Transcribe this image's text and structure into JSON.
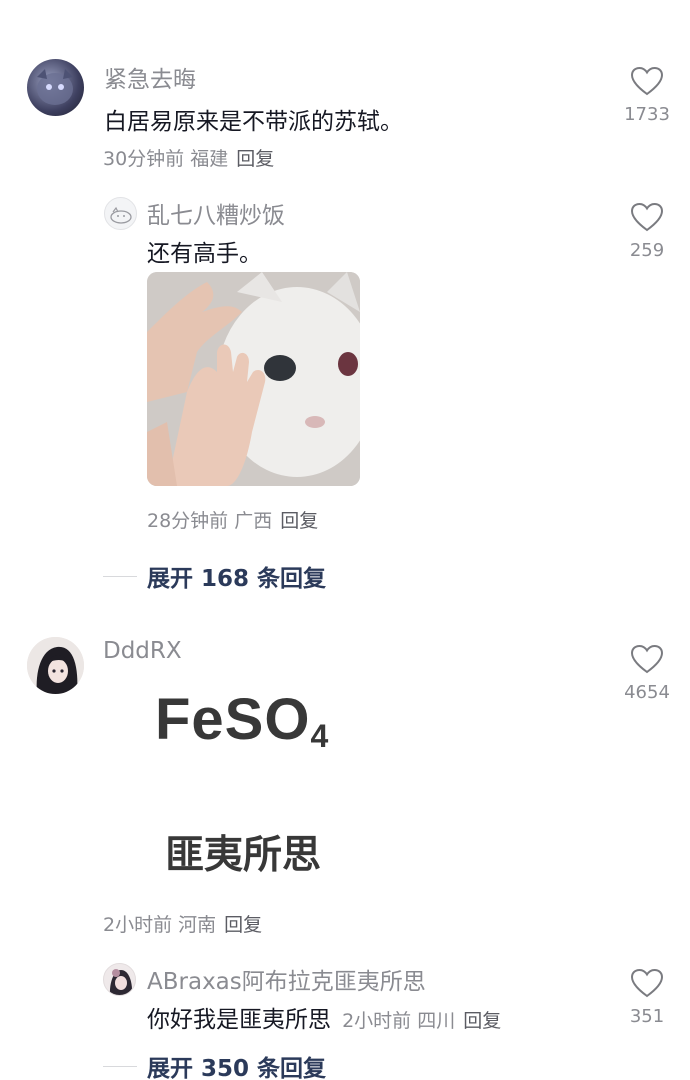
{
  "comments": [
    {
      "username": "紧急去晦",
      "text": "白居易原来是不带派的苏轼。",
      "time": "30分钟前",
      "location": "福建",
      "reply_label": "回复",
      "likes": "1733",
      "replies": [
        {
          "username": "乱七八糟炒饭",
          "text": "还有高手。",
          "time": "28分钟前",
          "location": "广西",
          "reply_label": "回复",
          "likes": "259"
        }
      ],
      "expand_label": "展开 168 条回复"
    },
    {
      "username": "DddRX",
      "image_text": {
        "formula_main": "FeSO",
        "formula_sub": "4",
        "caption": "匪夷所思"
      },
      "time": "2小时前",
      "location": "河南",
      "reply_label": "回复",
      "likes": "4654",
      "replies": [
        {
          "username": "ABraxas阿布拉克匪夷所思",
          "text": "你好我是匪夷所思",
          "time": "2小时前",
          "location": "四川",
          "reply_label": "回复",
          "likes": "351"
        }
      ],
      "expand_label": "展开 350 条回复"
    }
  ],
  "colors": {
    "text": "#161823",
    "secondary": "#8a8b91",
    "expand": "#2b3a5a"
  },
  "icons": {
    "like": "heart-outline-icon"
  }
}
